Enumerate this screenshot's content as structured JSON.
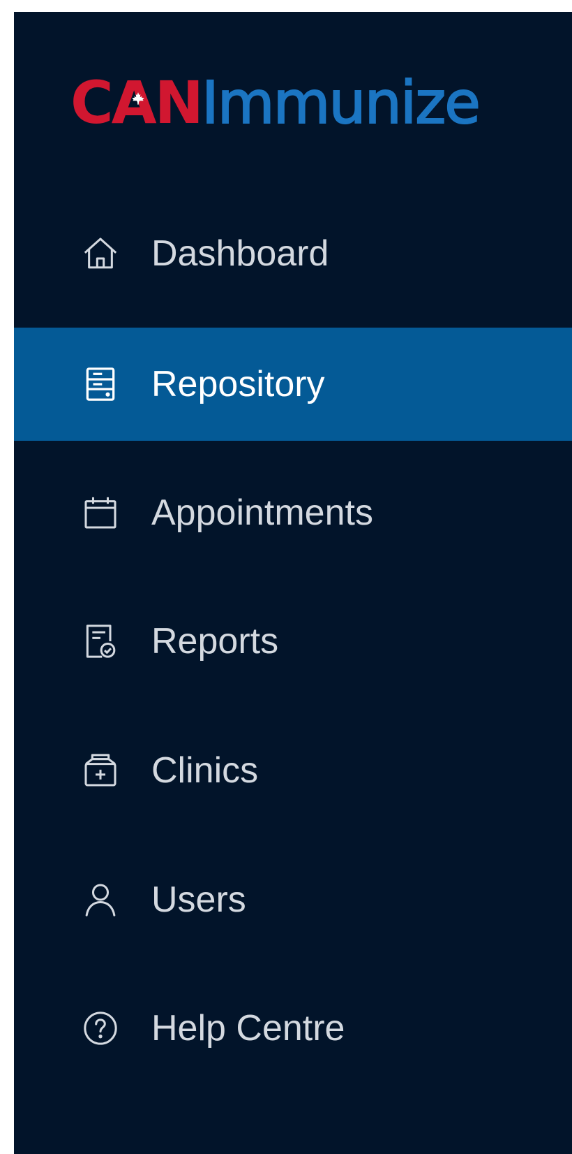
{
  "brand": {
    "part1": "CAN",
    "part2": "Immunize",
    "colors": {
      "red": "#d11730",
      "blue": "#1b75c2"
    }
  },
  "sidebar": {
    "background": "#02142a",
    "active_color": "#045a96",
    "items": [
      {
        "label": "Dashboard",
        "icon": "home-icon",
        "active": false
      },
      {
        "label": "Repository",
        "icon": "repository-icon",
        "active": true
      },
      {
        "label": "Appointments",
        "icon": "calendar-icon",
        "active": false
      },
      {
        "label": "Reports",
        "icon": "report-icon",
        "active": false
      },
      {
        "label": "Clinics",
        "icon": "clinic-icon",
        "active": false
      },
      {
        "label": "Users",
        "icon": "user-icon",
        "active": false
      },
      {
        "label": "Help Centre",
        "icon": "help-icon",
        "active": false
      }
    ]
  }
}
